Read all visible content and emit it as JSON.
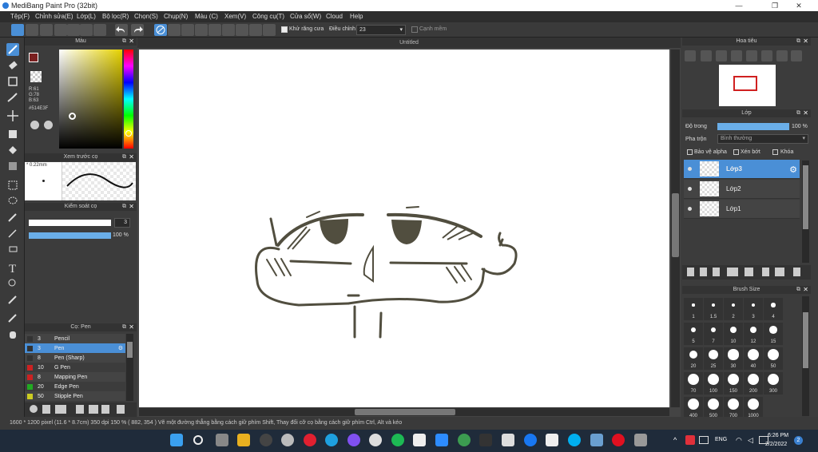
{
  "title": "MediBang Paint Pro (32bit)",
  "menu": [
    "Tệp(F)",
    "Chỉnh sửa(E)",
    "Lớp(L)",
    "Bộ lọc(R)",
    "Chọn(S)",
    "Chụp(N)",
    "Màu (C)",
    "Xem(V)",
    "Công cụ(T)",
    "Cửa sổ(W)",
    "Cloud",
    "Help"
  ],
  "toolbar": {
    "antialias": "Khử răng cưa",
    "adjust_label": "Điều chỉnh",
    "adjust_value": "23",
    "correction": "Cạnh mềm"
  },
  "color_panel": {
    "title": "Màu",
    "r": "R:61",
    "g": "G:78",
    "b": "B:63",
    "hex": "#514E3F",
    "fg": "#7a2020"
  },
  "brush_preview": {
    "title": "Xem trước cọ",
    "size": "0.22mm"
  },
  "brush_control": {
    "title": "Kiểm soát cọ",
    "size": "3",
    "opacity": "100 %",
    "opacity_fraction": 1.0
  },
  "brush_list": {
    "title": "Cọ: Pen",
    "items": [
      {
        "num": "3",
        "name": "Pencil",
        "color": "#333333"
      },
      {
        "num": "3",
        "name": "Pen",
        "color": "#333333",
        "active": true
      },
      {
        "num": "8",
        "name": "Pen (Sharp)",
        "color": "#333333"
      },
      {
        "num": "10",
        "name": "G Pen",
        "color": "#cc2222"
      },
      {
        "num": "8",
        "name": "Mapping Pen",
        "color": "#cc2222"
      },
      {
        "num": "20",
        "name": "Edge Pen",
        "color": "#22aa22"
      },
      {
        "num": "50",
        "name": "Stipple Pen",
        "color": "#cccc22"
      }
    ]
  },
  "canvas_title": "Untitled",
  "navigator": {
    "title": "Hoa tiêu"
  },
  "layer_panel": {
    "title": "Lớp",
    "opacity_label": "Độ trong",
    "opacity_value": "100 %",
    "opacity_fraction": 1.0,
    "blend_label": "Pha trộn",
    "blend_value": "Bình thường",
    "protect_alpha": "Bảo vệ alpha",
    "clip": "Xén bớt",
    "lock": "Khóa",
    "layers": [
      {
        "name": "Lớp3",
        "active": true
      },
      {
        "name": "Lớp2"
      },
      {
        "name": "Lớp1"
      }
    ]
  },
  "brush_size": {
    "title": "Brush Size",
    "sizes": [
      "1",
      "1.5",
      "2",
      "3",
      "4",
      "5",
      "7",
      "10",
      "12",
      "15",
      "20",
      "25",
      "30",
      "40",
      "50",
      "70",
      "100",
      "150",
      "200",
      "300",
      "400",
      "500",
      "700",
      "1000"
    ]
  },
  "status": "1600 * 1200 pixel  (11.6 * 8.7cm)  350 dpi  150 %  ( 882, 354 )  Vẽ một đường thẳng bằng cách giữ phím Shift, Thay đổi cỡ cọ bằng cách giữ phím Ctrl, Alt và kéo",
  "taskbar": {
    "lang": "ENG",
    "time": "6:26 PM",
    "date": "2/2/2022",
    "notif": "2"
  }
}
